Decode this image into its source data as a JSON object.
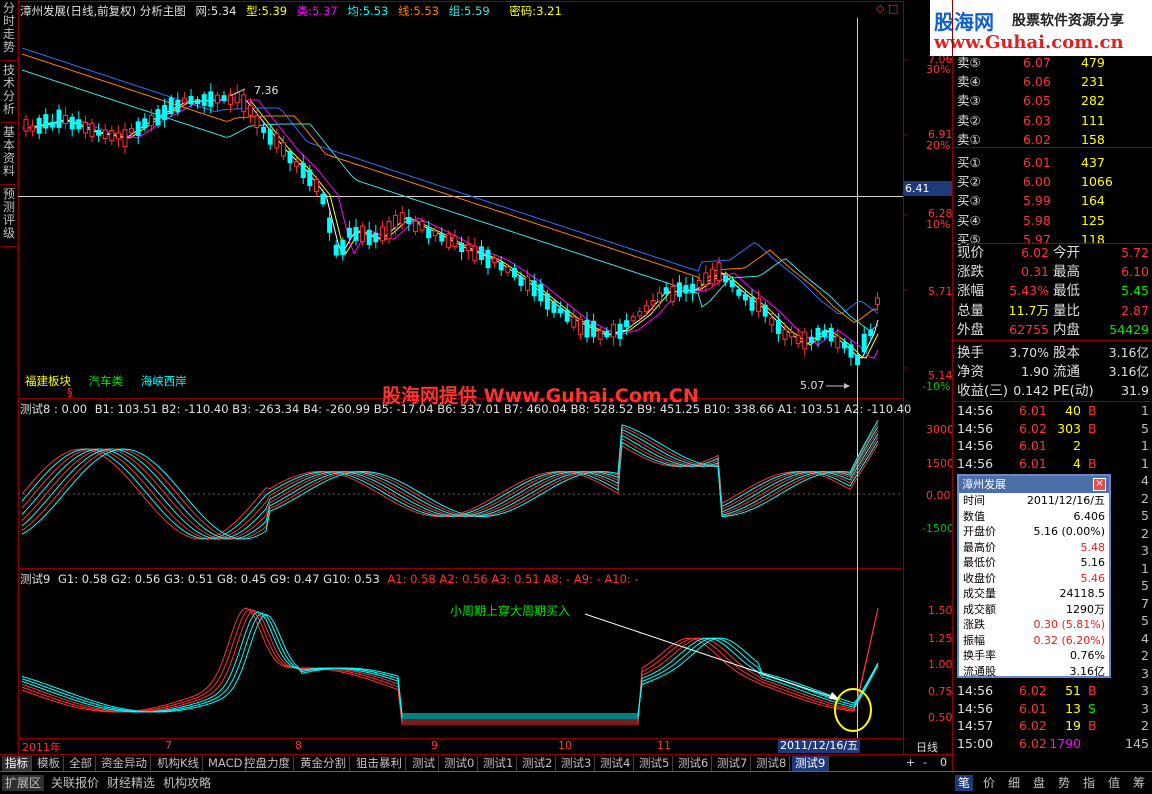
{
  "header": {
    "title": "漳州发展(日线,前复权) 分析主图",
    "wang_label": "网:",
    "wang": "5.34",
    "xing_label": "型:",
    "xing": "5.39",
    "lei_label": "类:",
    "lei": "5.37",
    "jun_label": "均:",
    "jun": "5.53",
    "xian_label": "线:",
    "xian": "5.53",
    "zu_label": "组:",
    "zu": "5.59",
    "mima_label": "密码:",
    "mima": "3.21"
  },
  "left_tabs": [
    "分时走势",
    "技术分析",
    "基本资料",
    "预测评级"
  ],
  "main_chart": {
    "high_marker": "7.36",
    "low_marker": "5.07",
    "cursor_price": "6.41",
    "axis": [
      {
        "price": "7.06",
        "pct": "30%"
      },
      {
        "price": "6.91",
        "pct": "20%"
      },
      {
        "price": "6.28",
        "pct": "10%"
      },
      {
        "price": "5.71",
        "pct": ""
      },
      {
        "price": "5.14",
        "pct": "-10%"
      }
    ],
    "sector_tags": [
      "福建板块",
      "汽车类",
      "海峡西岸"
    ],
    "sector_mark": "§",
    "watermark": "股海网提供 Www.Guhai.Com.CN"
  },
  "indicator1": {
    "name": "测试8 : 0.00",
    "values": "B1: 103.51  B2: -110.40  B3: -263.34  B4: -260.99  B5: -17.04  B6: 337.01  B7: 460.04  B8: 528.52  B9: 451.25  B10: 338.66  A1: 103.51  A2: -110.40",
    "axis": [
      "3000",
      "1500",
      "0.00",
      "-1500"
    ]
  },
  "indicator2": {
    "name": "测试9",
    "values": "G1: 0.58  G2: 0.56  G3: 0.51  G8: 0.45  G9: 0.47  G10: 0.53",
    "values_red": "A1: 0.58  A2: 0.56  A3: 0.51  A8: -  A9: -  A10: -",
    "annotation": "小周期上穿大周期买入",
    "axis": [
      "1.50",
      "1.25",
      "1.00",
      "0.75",
      "0.50"
    ]
  },
  "x_axis": {
    "labels": [
      "2011年",
      "7",
      "8",
      "9",
      "10",
      "11"
    ],
    "cursor_date": "2011/12/16/五",
    "period": "日线"
  },
  "bottom_tabs": [
    "指标",
    "模板",
    "全部",
    "资金异动",
    "机构K线",
    "MACD",
    "控盘力度",
    "黄金分割",
    "狙击暴利",
    "测试",
    "测试0",
    "测试1",
    "测试2",
    "测试3",
    "测试4",
    "测试5",
    "测试6",
    "测试7",
    "测试8",
    "测试9"
  ],
  "bottom_controls": [
    "+",
    "-",
    "0"
  ],
  "status_tabs": [
    "扩展区",
    "关联报价",
    "财经精选",
    "机构攻略"
  ],
  "logo": {
    "name": "股海网",
    "slogan": "股票软件资源分享",
    "url": "www.Guhai.com.cn"
  },
  "order_book": {
    "sell": [
      {
        "label": "卖⑤",
        "price": "6.07",
        "vol": "479"
      },
      {
        "label": "卖④",
        "price": "6.06",
        "vol": "231"
      },
      {
        "label": "卖③",
        "price": "6.05",
        "vol": "282"
      },
      {
        "label": "卖②",
        "price": "6.03",
        "vol": "111"
      },
      {
        "label": "卖①",
        "price": "6.02",
        "vol": "158"
      }
    ],
    "buy": [
      {
        "label": "买①",
        "price": "6.01",
        "vol": "437"
      },
      {
        "label": "买②",
        "price": "6.00",
        "vol": "1066"
      },
      {
        "label": "买③",
        "price": "5.99",
        "vol": "164"
      },
      {
        "label": "买④",
        "price": "5.98",
        "vol": "125"
      },
      {
        "label": "买⑤",
        "price": "5.97",
        "vol": "118"
      }
    ]
  },
  "quote": [
    {
      "k1": "现价",
      "v1": "6.02",
      "k2": "今开",
      "v2": "5.72"
    },
    {
      "k1": "涨跌",
      "v1": "0.31",
      "k2": "最高",
      "v2": "6.10"
    },
    {
      "k1": "涨幅",
      "v1": "5.43%",
      "k2": "最低",
      "v2": "5.45"
    },
    {
      "k1": "总量",
      "v1": "11.7万",
      "k2": "量比",
      "v2": "2.87"
    },
    {
      "k1": "外盘",
      "v1": "62755",
      "k2": "内盘",
      "v2": "54429"
    },
    {
      "k1": "换手",
      "v1": "3.70%",
      "k2": "股本",
      "v2": "3.16亿"
    },
    {
      "k1": "净资",
      "v1": "1.90",
      "k2": "流通",
      "v2": "3.16亿"
    },
    {
      "k1": "收益(三)",
      "v1": "0.142",
      "k2": "PE(动)",
      "v2": "31.9"
    }
  ],
  "ticks": [
    {
      "time": "14:56",
      "price": "6.01",
      "vol": "40",
      "side": "B",
      "n": "1"
    },
    {
      "time": "14:56",
      "price": "6.02",
      "vol": "303",
      "side": "B",
      "n": "5"
    },
    {
      "time": "14:56",
      "price": "6.01",
      "vol": "2",
      "side": "",
      "n": "1"
    },
    {
      "time": "14:56",
      "price": "6.01",
      "vol": "4",
      "side": "B",
      "n": "1"
    },
    {
      "time": "",
      "price": "",
      "vol": "",
      "side": "B",
      "n": "4"
    },
    {
      "time": "",
      "price": "",
      "vol": "",
      "side": "S",
      "n": "2"
    },
    {
      "time": "",
      "price": "",
      "vol": "",
      "side": "S",
      "n": "5"
    },
    {
      "time": "",
      "price": "",
      "vol": "",
      "side": "S",
      "n": "2"
    },
    {
      "time": "",
      "price": "",
      "vol": "",
      "side": "S",
      "n": "3"
    },
    {
      "time": "",
      "price": "",
      "vol": "",
      "side": "B",
      "n": "1"
    },
    {
      "time": "",
      "price": "",
      "vol": "",
      "side": "S",
      "n": "5"
    },
    {
      "time": "",
      "price": "",
      "vol": "",
      "side": "S",
      "n": "7"
    },
    {
      "time": "",
      "price": "",
      "vol": "",
      "side": "S",
      "n": "5"
    },
    {
      "time": "",
      "price": "",
      "vol": "",
      "side": "B",
      "n": "4"
    },
    {
      "time": "",
      "price": "",
      "vol": "",
      "side": "S",
      "n": "2"
    },
    {
      "time": "14:56",
      "price": "6.02",
      "vol": "40",
      "side": "B",
      "n": "3"
    },
    {
      "time": "14:56",
      "price": "6.02",
      "vol": "51",
      "side": "B",
      "n": "3"
    },
    {
      "time": "14:56",
      "price": "6.01",
      "vol": "13",
      "side": "S",
      "n": "3"
    },
    {
      "time": "14:57",
      "price": "6.02",
      "vol": "19",
      "side": "B",
      "n": "2"
    },
    {
      "time": "15:00",
      "price": "6.02",
      "vol": "1790",
      "side": "",
      "n": "145"
    }
  ],
  "panel_tabs": [
    "笔",
    "价",
    "细",
    "盘",
    "势",
    "指",
    "值",
    "筹"
  ],
  "popup": {
    "title": "漳州发展",
    "rows": [
      {
        "k": "时间",
        "v": "2011/12/16/五"
      },
      {
        "k": "数值",
        "v": "6.406"
      },
      {
        "k": "开盘价",
        "v": "5.16 (0.00%)"
      },
      {
        "k": "最高价",
        "v": "5.48"
      },
      {
        "k": "最低价",
        "v": "5.16"
      },
      {
        "k": "收盘价",
        "v": "5.46"
      },
      {
        "k": "成交量",
        "v": "24118.5"
      },
      {
        "k": "成交额",
        "v": "1290万"
      },
      {
        "k": "涨跌",
        "v": "0.30 (5.81%)"
      },
      {
        "k": "振幅",
        "v": "0.32 (6.20%)"
      },
      {
        "k": "换手率",
        "v": "0.76%"
      },
      {
        "k": "流通股",
        "v": "3.16亿"
      }
    ]
  },
  "colors": {
    "up": "#ff3232",
    "down": "#00ffff",
    "frame": "#8b0000",
    "ma1": "#ffffff",
    "ma2": "#ffff00",
    "ma3": "#ff00ff",
    "ma4": "#00c000",
    "ma5": "#3070ff",
    "ma6": "#ff8000",
    "ma7": "#40e0e0"
  }
}
